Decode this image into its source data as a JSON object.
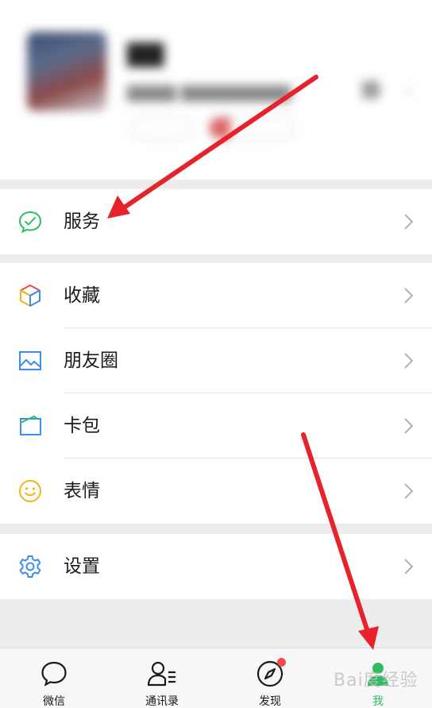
{
  "menu": {
    "service": {
      "label": "服务",
      "icon": "service-icon"
    },
    "items": [
      {
        "label": "收藏",
        "icon": "favorites-cube-icon"
      },
      {
        "label": "朋友圈",
        "icon": "moments-picture-icon"
      },
      {
        "label": "卡包",
        "icon": "card-wallet-icon"
      },
      {
        "label": "表情",
        "icon": "sticker-smile-icon"
      }
    ],
    "settings": {
      "label": "设置",
      "icon": "gear-icon"
    }
  },
  "tabbar": {
    "tabs": [
      {
        "label": "微信",
        "icon": "chat-bubble-icon"
      },
      {
        "label": "通讯录",
        "icon": "contacts-icon"
      },
      {
        "label": "发现",
        "icon": "compass-icon",
        "badge": true
      },
      {
        "label": "我",
        "icon": "me-person-icon",
        "active": true
      }
    ]
  },
  "watermark": {
    "text": "Bai度经验"
  },
  "colors": {
    "accent_green": "#2fbd60",
    "annotation_red": "#e8222a",
    "badge_red": "#f04a4a",
    "page_bg": "#ededed"
  }
}
